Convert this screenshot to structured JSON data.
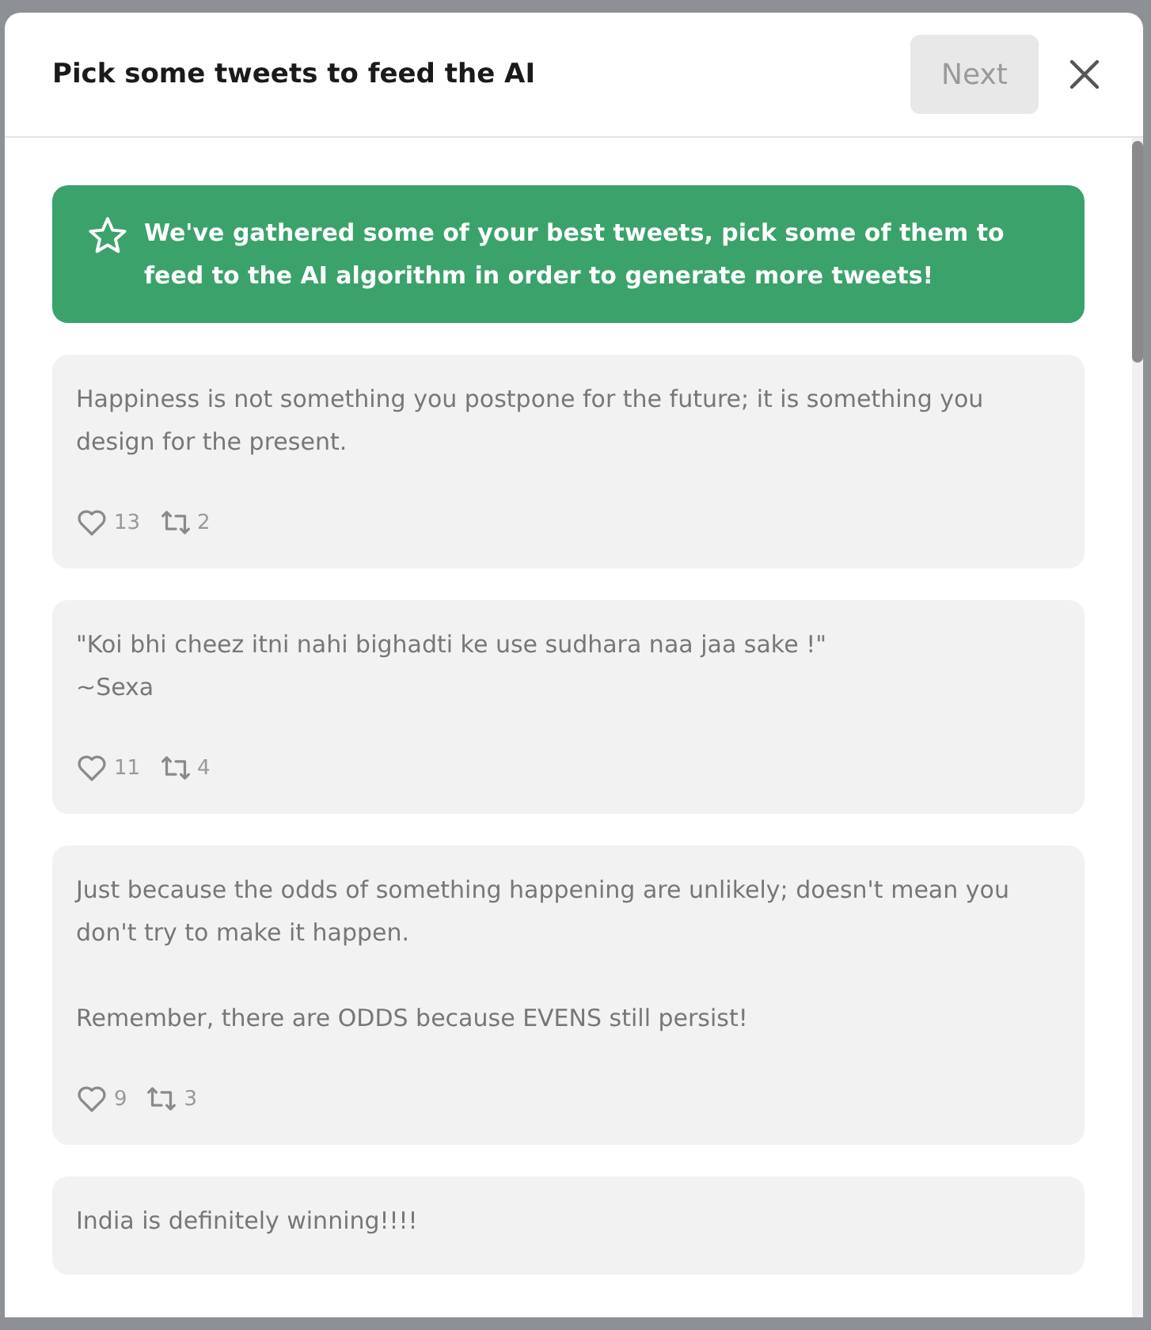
{
  "dialog": {
    "title": "Pick some tweets to feed the AI",
    "next_button": {
      "label": "Next",
      "disabled": true
    }
  },
  "notice": "We've gathered some of your best tweets, pick some of them to feed to the AI algorithm in order to generate more tweets!",
  "tweets": [
    {
      "text": "Happiness is not something you postpone for the future; it is something you design for the present.",
      "likes": "13",
      "retweets": "2"
    },
    {
      "text": "\"Koi bhi cheez itni nahi bighadti ke use sudhara naa jaa sake !\"\n~Sexa",
      "likes": "11",
      "retweets": "4"
    },
    {
      "text": "Just because the odds of something happening are unlikely; doesn't mean you don't try to make it happen.\n\nRemember, there are ODDS because EVENS still persist!",
      "likes": "9",
      "retweets": "3"
    },
    {
      "text": "India is definitely winning!!!!"
    }
  ]
}
